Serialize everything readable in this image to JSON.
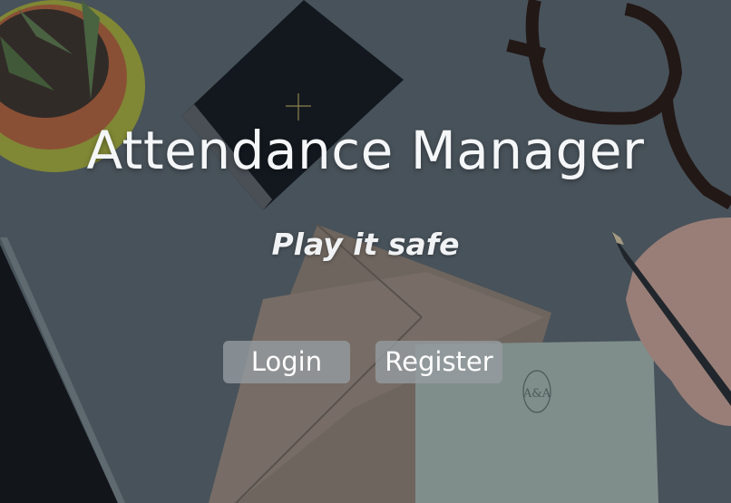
{
  "hero": {
    "title": "Attendance Manager",
    "tagline": "Play it safe"
  },
  "actions": {
    "login_label": "Login",
    "register_label": "Register"
  },
  "background": {
    "scene": "desk-photo",
    "envelope_monogram": "A&A"
  },
  "colors": {
    "text": "#ffffff",
    "button_bg": "#969ca2"
  }
}
